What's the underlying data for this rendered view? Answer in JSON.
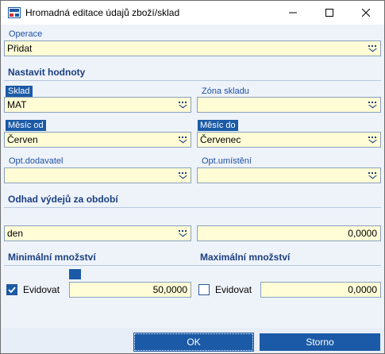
{
  "window": {
    "title": "Hromadná editace údajů zboží/sklad"
  },
  "operace": {
    "label": "Operace",
    "value": "Přidat"
  },
  "nastavit": {
    "heading": "Nastavit hodnoty"
  },
  "sklad": {
    "label": "Sklad",
    "value": "MAT"
  },
  "zona": {
    "label": "Zóna skladu",
    "value": ""
  },
  "mesic_od": {
    "label": "Měsíc od",
    "value": "Červen"
  },
  "mesic_do": {
    "label": "Měsíc do",
    "value": "Červenec"
  },
  "opt_dodavatel": {
    "label": "Opt.dodavatel",
    "value": ""
  },
  "opt_umisteni": {
    "label": "Opt.umístění",
    "value": ""
  },
  "odhad": {
    "heading": "Odhad výdejů za období",
    "unit_value": "den",
    "amount": "0,0000"
  },
  "min": {
    "heading": "Minimální množství",
    "evidovat_label": "Evidovat",
    "checked": true,
    "value": "50,0000"
  },
  "max": {
    "heading": "Maximální množství",
    "evidovat_label": "Evidovat",
    "checked": false,
    "value": "0,0000"
  },
  "buttons": {
    "ok": "OK",
    "storno": "Storno"
  },
  "colors": {
    "accent": "#1b5aa6",
    "field_bg": "#fffcd6",
    "window_bg": "#eef3fa"
  }
}
